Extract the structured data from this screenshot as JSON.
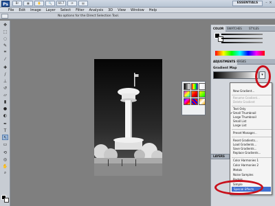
{
  "app": {
    "logo": "Ps",
    "zoom": "66.7",
    "workspace": "ESSENTIALS"
  },
  "menu": [
    "File",
    "Edit",
    "Image",
    "Layer",
    "Select",
    "Filter",
    "Analysis",
    "3D",
    "View",
    "Window",
    "Help"
  ],
  "options_bar": {
    "message": "No options for the Direct Selection Tool."
  },
  "panels": {
    "color_tabs": [
      "COLOR",
      "SWATCHES",
      "STYLES"
    ],
    "adjust_tabs": [
      "ADJUSTMENTS",
      "MASKS"
    ],
    "adjust_title": "Gradient Map",
    "layers_tab": "LAYERS"
  },
  "popup_menu": {
    "items": [
      {
        "label": "New Gradient...",
        "disabled": false
      },
      {
        "label": "Rename Gradient...",
        "disabled": true
      },
      {
        "label": "Delete Gradient",
        "disabled": true
      },
      {
        "label": "Text Only",
        "disabled": false
      },
      {
        "label": "Small Thumbnail",
        "disabled": false,
        "checked": true
      },
      {
        "label": "Large Thumbnail",
        "disabled": false
      },
      {
        "label": "Small List",
        "disabled": false
      },
      {
        "label": "Large List",
        "disabled": false
      },
      {
        "label": "Preset Manager...",
        "disabled": false
      },
      {
        "label": "Reset Gradients...",
        "disabled": false
      },
      {
        "label": "Load Gradients...",
        "disabled": false
      },
      {
        "label": "Save Gradients...",
        "disabled": false
      },
      {
        "label": "Replace Gradients...",
        "disabled": false
      },
      {
        "label": "Color Harmonies 1",
        "disabled": false
      },
      {
        "label": "Color Harmonies 2",
        "disabled": false
      },
      {
        "label": "Metals",
        "disabled": false
      },
      {
        "label": "Noise Samples",
        "disabled": false
      },
      {
        "label": "Pastels",
        "disabled": false
      },
      {
        "label": "Simple",
        "disabled": false
      },
      {
        "label": "Special Effects",
        "disabled": false,
        "highlighted": true
      }
    ]
  },
  "colors": {
    "highlight": "#3f6fd0",
    "annotation": "#c8101b"
  }
}
